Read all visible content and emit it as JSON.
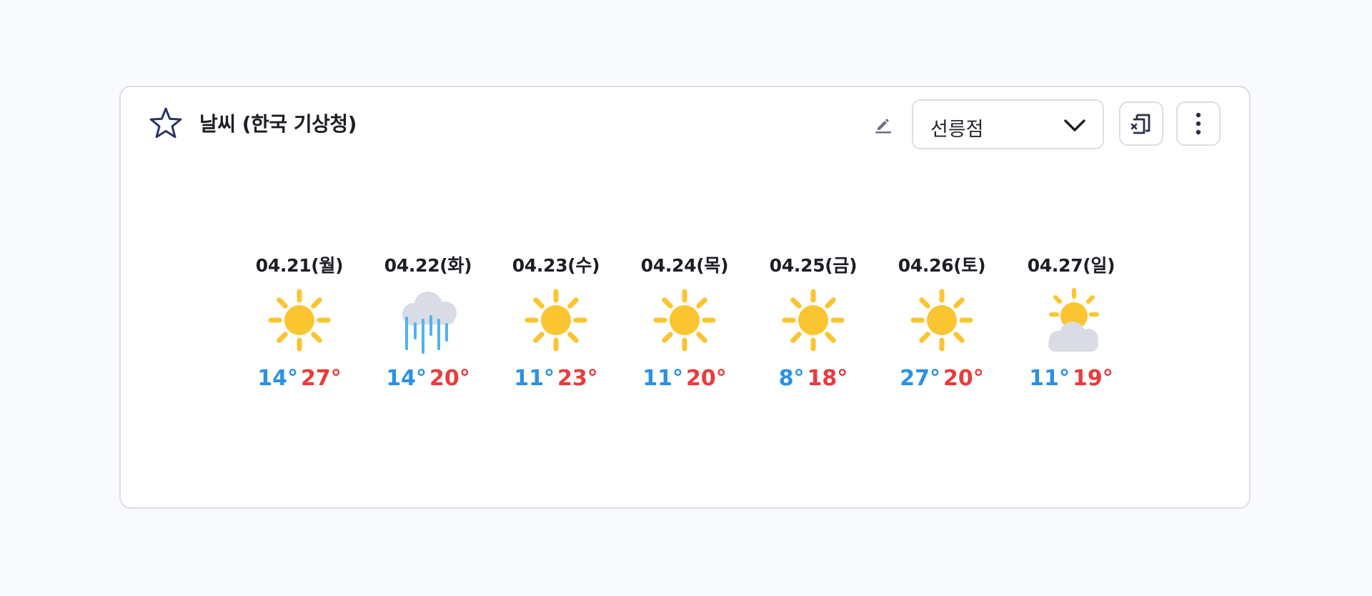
{
  "widget": {
    "title": "날씨 (한국 기상청)",
    "location_select": {
      "value": "선릉점"
    }
  },
  "icons": {
    "favorite": "star-outline-icon",
    "edit": "pencil-icon",
    "dropdown": "chevron-down-icon",
    "export": "export-icon",
    "more": "more-vertical-icon"
  },
  "colors": {
    "low_temp": "#2a91e6",
    "high_temp": "#ea3b3b",
    "sun": "#fbc531",
    "cloud": "#d9dbe5",
    "rain": "#4fb3f0"
  },
  "forecast": [
    {
      "date": "04.21(월)",
      "condition": "sunny",
      "low": "14°",
      "high": "27°"
    },
    {
      "date": "04.22(화)",
      "condition": "rain",
      "low": "14°",
      "high": "20°"
    },
    {
      "date": "04.23(수)",
      "condition": "sunny",
      "low": "11°",
      "high": "23°"
    },
    {
      "date": "04.24(목)",
      "condition": "sunny",
      "low": "11°",
      "high": "20°"
    },
    {
      "date": "04.25(금)",
      "condition": "sunny",
      "low": "8°",
      "high": "18°"
    },
    {
      "date": "04.26(토)",
      "condition": "sunny",
      "low": "27°",
      "high": "20°"
    },
    {
      "date": "04.27(일)",
      "condition": "partly-cloudy",
      "low": "11°",
      "high": "19°"
    }
  ]
}
